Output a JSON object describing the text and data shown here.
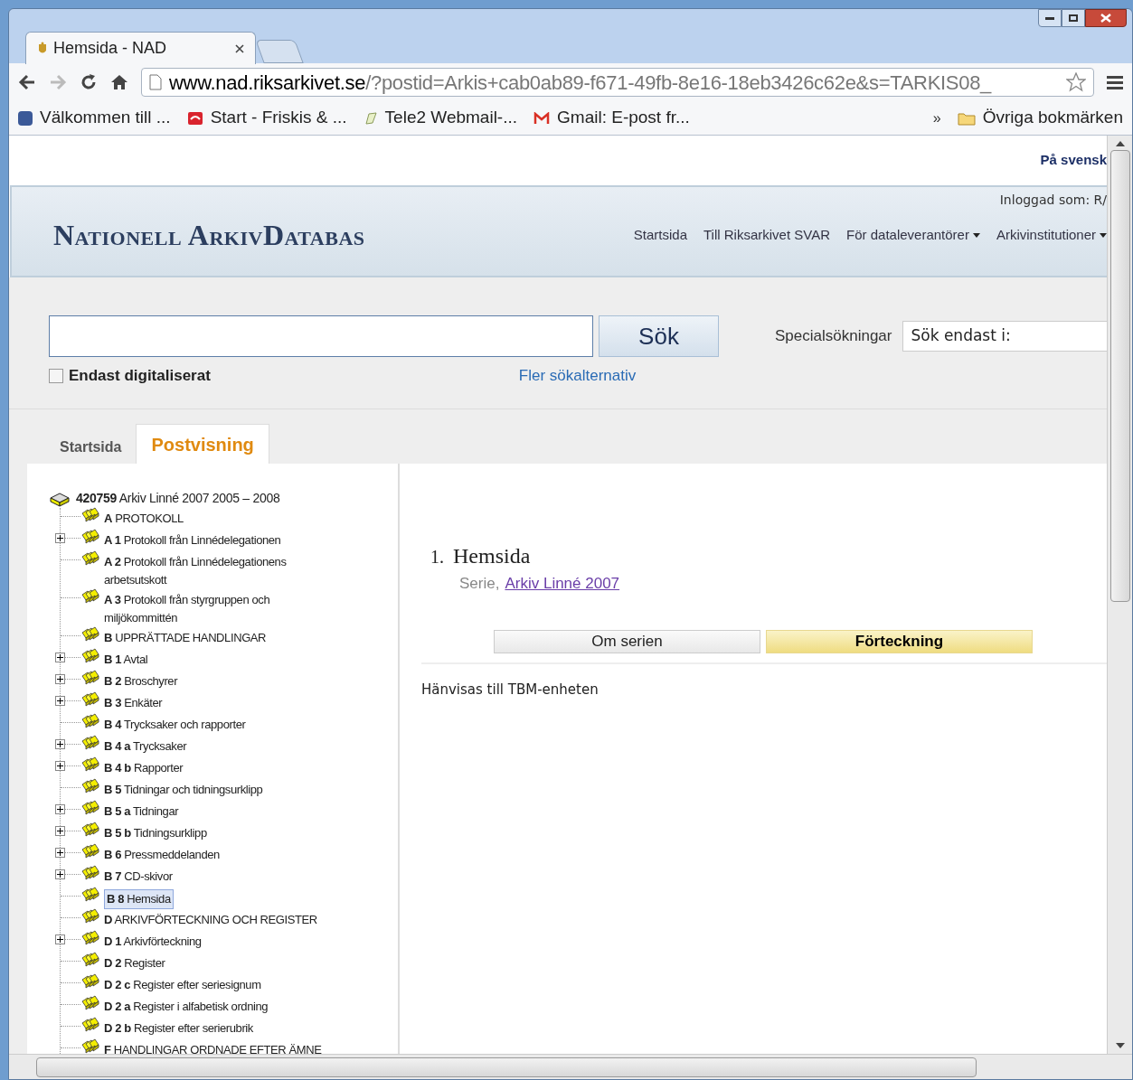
{
  "browser": {
    "tab_title": "Hemsida - NAD",
    "url_host": "www.nad.riksarkivet.se",
    "url_rest": "/?postid=Arkis+cab0ab89-f671-49fb-8e16-18eb3426c62e&s=TARKIS08_",
    "bookmarks": [
      {
        "label": "Välkommen till ...",
        "kind": "facebook"
      },
      {
        "label": "Start - Friskis & ...",
        "kind": "friskis"
      },
      {
        "label": "Tele2 Webmail-...",
        "kind": "leaf"
      },
      {
        "label": "Gmail: E-post fr...",
        "kind": "gmail"
      }
    ],
    "more": "»",
    "other_bookmarks": "Övriga bokmärken"
  },
  "top_bar": {
    "language_link": "På svensk"
  },
  "header": {
    "logo": "Nationell ArkivDatabas",
    "logged_in": "Inloggad som: R/",
    "nav": [
      {
        "label": "Startsida",
        "dropdown": false
      },
      {
        "label": "Till Riksarkivet SVAR",
        "dropdown": false
      },
      {
        "label": "För dataleverantörer",
        "dropdown": true
      },
      {
        "label": "Arkivinstitutioner",
        "dropdown": true
      }
    ]
  },
  "search": {
    "button": "Sök",
    "checkbox_label": "Endast digitaliserat",
    "checked": false,
    "more_options": "Fler sökalternativ",
    "special_label": "Specialsökningar",
    "special_value": "Sök endast i:"
  },
  "tabs": [
    {
      "label": "Startsida",
      "selected": false
    },
    {
      "label": "Postvisning",
      "selected": true
    }
  ],
  "tree": {
    "code": "420759",
    "label": "Arkiv Linné 2007 2005 – 2008",
    "children": [
      {
        "code": "A",
        "label": "PROTOKOLL",
        "expandable": false,
        "selected": false
      },
      {
        "code": "A 1",
        "label": "Protokoll från Linnédelegationen",
        "expandable": true,
        "selected": false
      },
      {
        "code": "A 2",
        "label": "Protokoll från Linnédelegationens arbetsutskott",
        "expandable": false,
        "selected": false
      },
      {
        "code": "A 3",
        "label": "Protokoll från styrgruppen och miljökommittén",
        "expandable": false,
        "selected": false
      },
      {
        "code": "B",
        "label": "UPPRÄTTADE HANDLINGAR",
        "expandable": false,
        "selected": false
      },
      {
        "code": "B 1",
        "label": "Avtal",
        "expandable": true,
        "selected": false
      },
      {
        "code": "B 2",
        "label": "Broschyrer",
        "expandable": true,
        "selected": false
      },
      {
        "code": "B 3",
        "label": "Enkäter",
        "expandable": true,
        "selected": false
      },
      {
        "code": "B 4",
        "label": "Trycksaker och rapporter",
        "expandable": false,
        "selected": false
      },
      {
        "code": "B 4 a",
        "label": "Trycksaker",
        "expandable": true,
        "selected": false
      },
      {
        "code": "B 4 b",
        "label": "Rapporter",
        "expandable": true,
        "selected": false
      },
      {
        "code": "B 5",
        "label": "Tidningar och tidningsurklipp",
        "expandable": false,
        "selected": false
      },
      {
        "code": "B 5 a",
        "label": "Tidningar",
        "expandable": true,
        "selected": false
      },
      {
        "code": "B 5 b",
        "label": "Tidningsurklipp",
        "expandable": true,
        "selected": false
      },
      {
        "code": "B 6",
        "label": "Pressmeddelanden",
        "expandable": true,
        "selected": false
      },
      {
        "code": "B 7",
        "label": "CD-skivor",
        "expandable": true,
        "selected": false
      },
      {
        "code": "B 8",
        "label": "Hemsida",
        "expandable": false,
        "selected": true
      },
      {
        "code": "D",
        "label": "ARKIVFÖRTECKNING OCH REGISTER",
        "expandable": false,
        "selected": false
      },
      {
        "code": "D 1",
        "label": "Arkivförteckning",
        "expandable": true,
        "selected": false
      },
      {
        "code": "D 2",
        "label": "Register",
        "expandable": false,
        "selected": false
      },
      {
        "code": "D 2 c",
        "label": "Register efter seriesignum",
        "expandable": false,
        "selected": false
      },
      {
        "code": "D 2 a",
        "label": "Register i alfabetisk ordning",
        "expandable": false,
        "selected": false
      },
      {
        "code": "D 2 b",
        "label": "Register efter serierubrik",
        "expandable": false,
        "selected": false
      },
      {
        "code": "F",
        "label": "HANDLINGAR ORDNADE EFTER ÄMNE",
        "expandable": false,
        "selected": false
      }
    ]
  },
  "detail": {
    "number": "1.",
    "title": "Hemsida",
    "type": "Serie,",
    "parent_link": "Arkiv Linné 2007",
    "tabs": [
      {
        "label": "Om serien",
        "selected": false
      },
      {
        "label": "Förteckning",
        "selected": true
      }
    ],
    "text": "Hänvisas till TBM-enheten"
  }
}
